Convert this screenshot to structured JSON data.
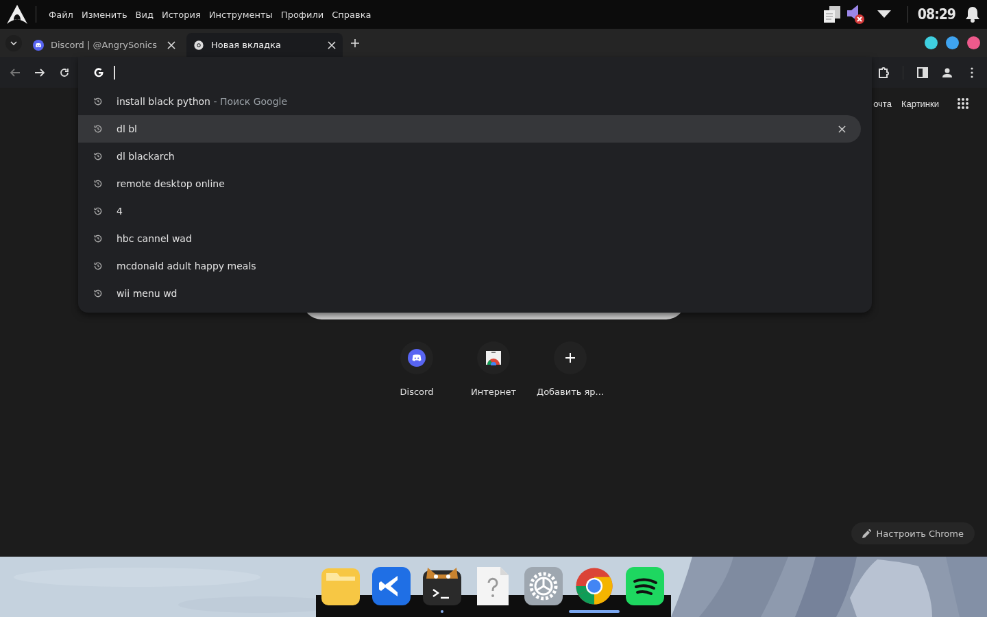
{
  "menu_bar": {
    "items": [
      "Файл",
      "Изменить",
      "Вид",
      "История",
      "Инструменты",
      "Профили",
      "Справка"
    ],
    "clock": "08:29"
  },
  "tabs": [
    {
      "title": "Discord | @AngrySonics",
      "kind": "discord",
      "selected": false
    },
    {
      "title": "Новая вкладка",
      "kind": "chrome",
      "selected": true
    }
  ],
  "window_dots": [
    {
      "color": "#3fd0e0"
    },
    {
      "color": "#3fa4f0"
    },
    {
      "color": "#ee5a8c"
    }
  ],
  "omnibox": {
    "suggestions": [
      {
        "text": "install black python",
        "suffix": " - Поиск Google",
        "selected": false
      },
      {
        "text": "dl bl",
        "selected": true
      },
      {
        "text": "dl blackarch",
        "selected": false
      },
      {
        "text": "remote desktop online",
        "selected": false
      },
      {
        "text": "4",
        "selected": false
      },
      {
        "text": "hbc cannel wad",
        "selected": false
      },
      {
        "text": "mcdonald adult happy meals",
        "selected": false
      },
      {
        "text": "wii menu wd",
        "selected": false
      }
    ]
  },
  "header_links": [
    "очта",
    "Картинки"
  ],
  "shortcuts": [
    {
      "label": "Discord",
      "kind": "discord"
    },
    {
      "label": "Интернет",
      "kind": "store"
    },
    {
      "label": "Добавить яр...",
      "kind": "add"
    }
  ],
  "customize_button": "Настроить Chrome",
  "dock": [
    {
      "kind": "files",
      "running": false,
      "active": false
    },
    {
      "kind": "code",
      "running": false,
      "active": false
    },
    {
      "kind": "terminal",
      "running": true,
      "active": false
    },
    {
      "kind": "unknown",
      "running": false,
      "active": false
    },
    {
      "kind": "settings",
      "running": false,
      "active": false
    },
    {
      "kind": "chrome",
      "running": true,
      "active": true
    },
    {
      "kind": "spotify",
      "running": false,
      "active": false
    }
  ]
}
